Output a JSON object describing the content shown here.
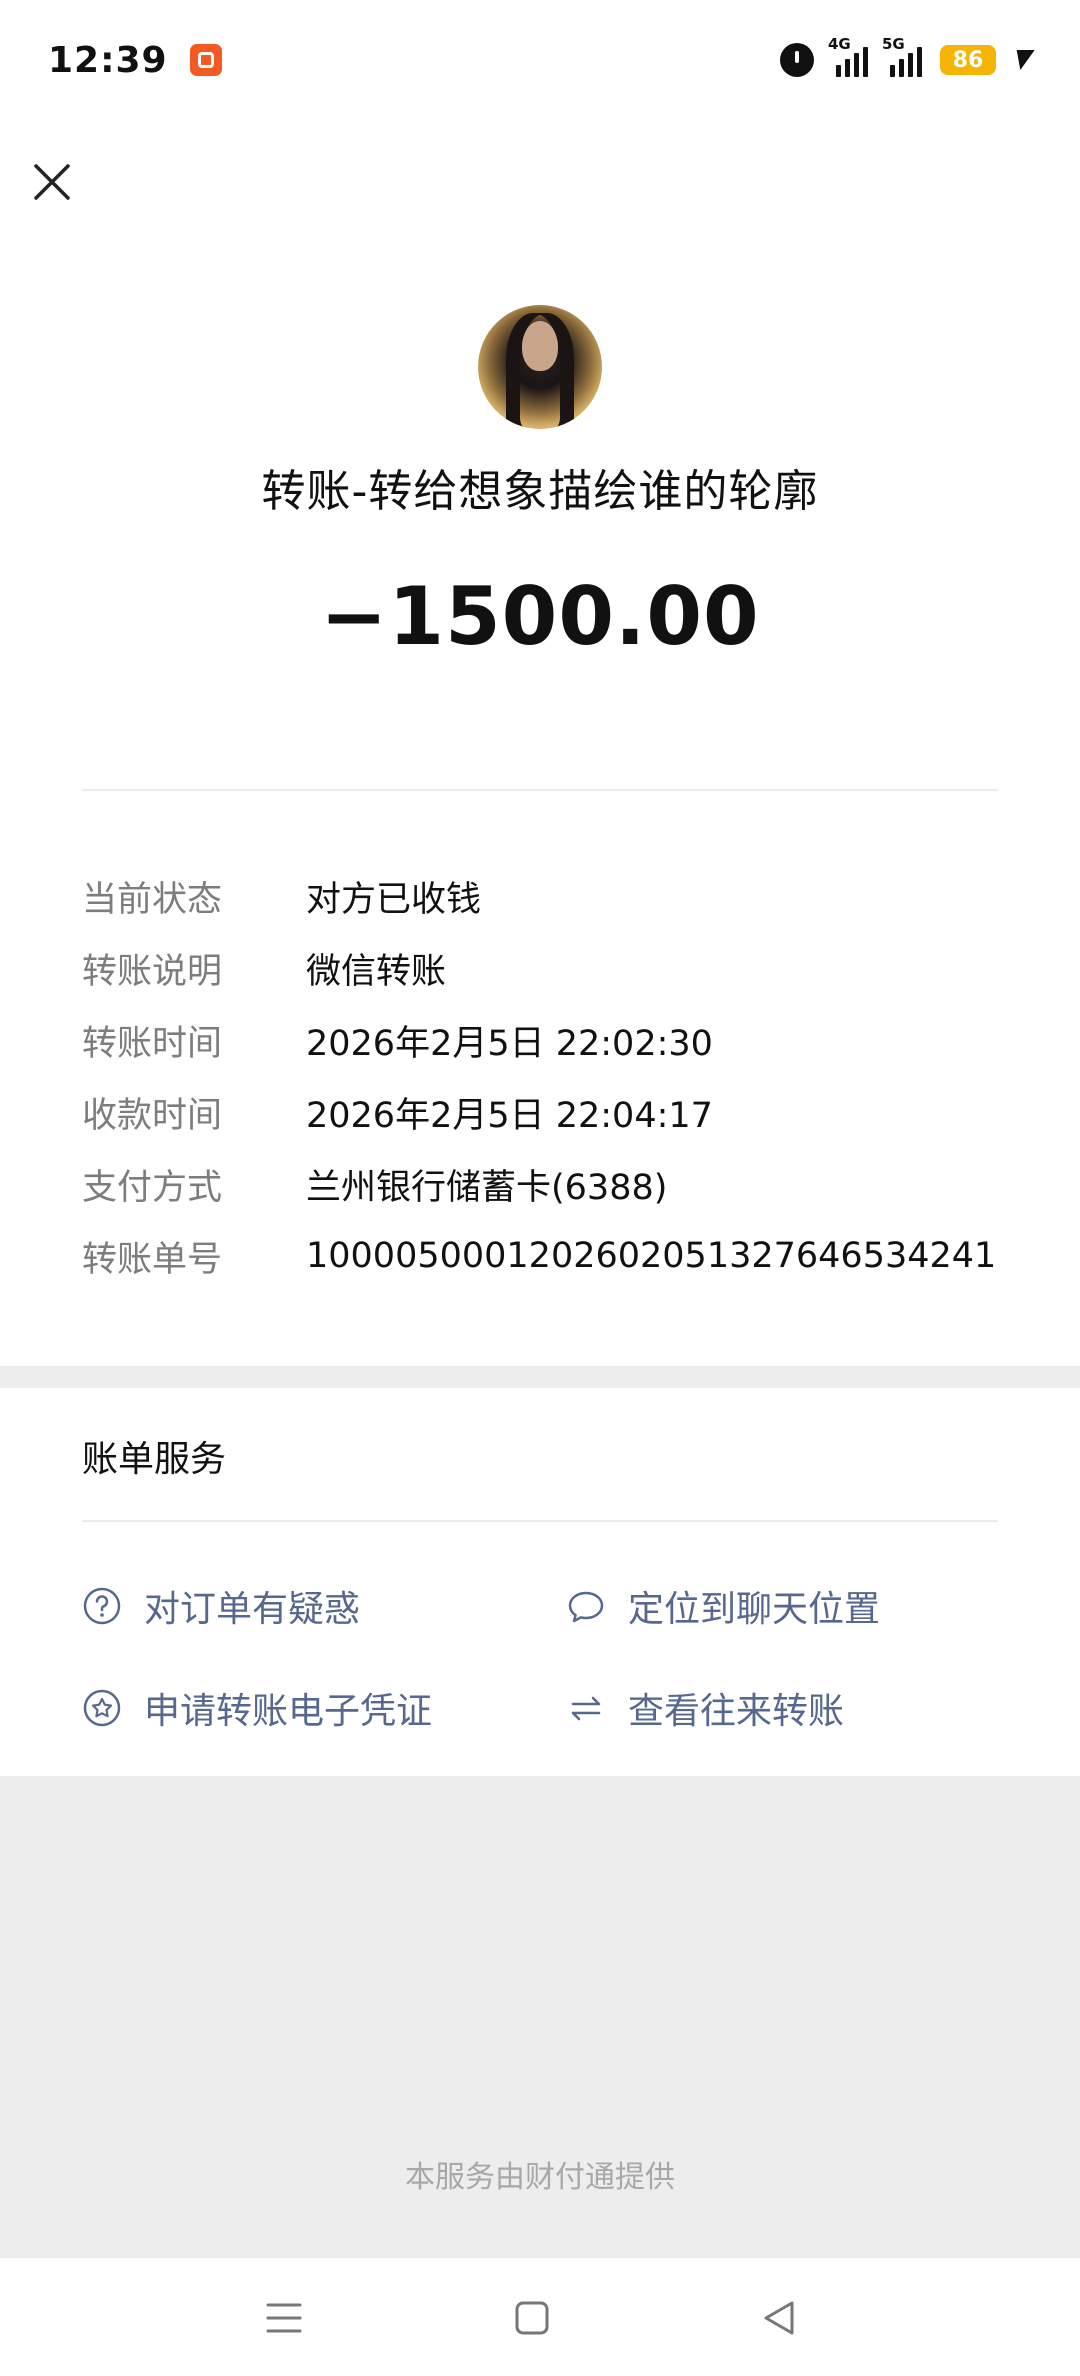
{
  "status_bar": {
    "time": "12:39",
    "net_4g": "4G",
    "net_5g": "5G",
    "battery": "86",
    "icons": [
      "app-badge-icon",
      "alarm-icon",
      "signal-4g-icon",
      "signal-5g-icon",
      "battery-icon",
      "charging-bolt-icon"
    ]
  },
  "header": {
    "close_icon": "close-icon"
  },
  "transaction": {
    "title": "转账-转给想象描绘谁的轮廓",
    "amount": "−1500.00"
  },
  "details": [
    {
      "label": "当前状态",
      "value": "对方已收钱"
    },
    {
      "label": "转账说明",
      "value": "微信转账"
    },
    {
      "label": "转账时间",
      "value": "2026年2月5日 22:02:30"
    },
    {
      "label": "收款时间",
      "value": "2026年2月5日 22:04:17"
    },
    {
      "label": "支付方式",
      "value": "兰州银行储蓄卡(6388)"
    },
    {
      "label": "转账单号",
      "value": "100005000120260205132764653424​1"
    }
  ],
  "services": {
    "title": "账单服务",
    "items": [
      {
        "label": "对订单有疑惑",
        "icon": "question-circle-icon"
      },
      {
        "label": "定位到聊天位置",
        "icon": "chat-bubble-icon"
      },
      {
        "label": "申请转账电子凭证",
        "icon": "star-circle-icon"
      },
      {
        "label": "查看往来转账",
        "icon": "swap-arrows-icon"
      }
    ]
  },
  "footer": {
    "provider_text": "本服务由财付通提供"
  },
  "nav": {
    "icons": [
      "menu-icon",
      "home-square-icon",
      "back-triangle-icon"
    ]
  },
  "colors": {
    "link": "#56688e",
    "label_gray": "#7d7d7d",
    "background": "#ededed",
    "battery": "#f5b400",
    "app_badge": "#f25a22"
  }
}
